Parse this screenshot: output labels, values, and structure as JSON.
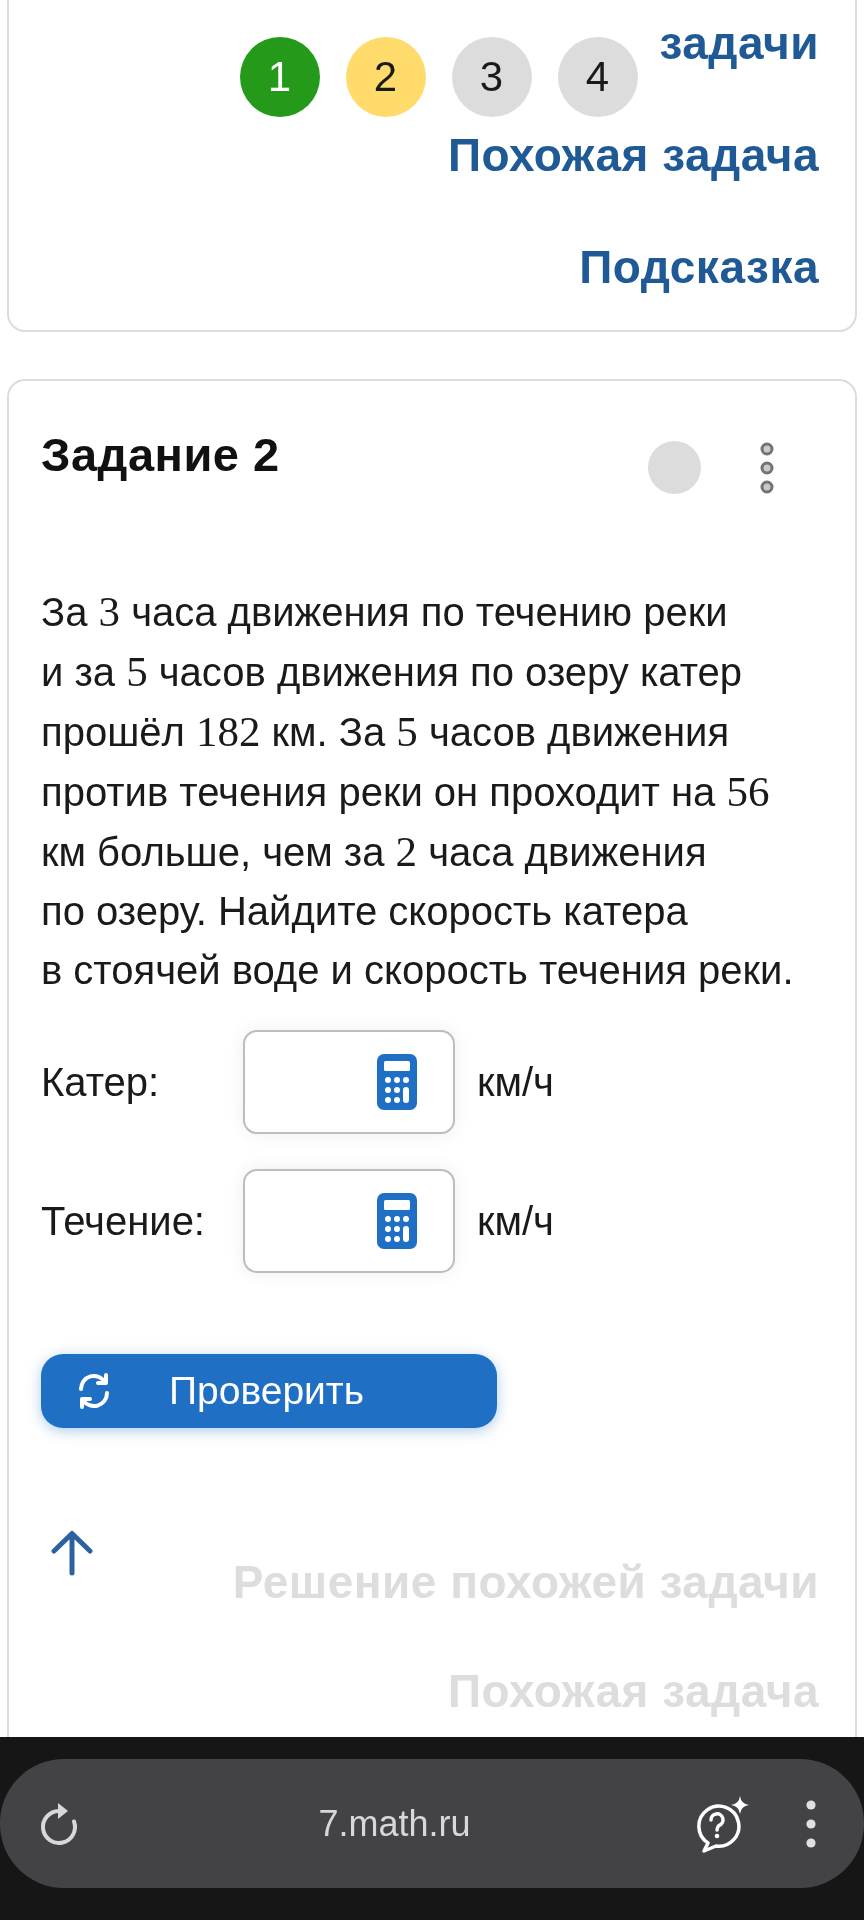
{
  "top_panel": {
    "steps": [
      {
        "label": "1",
        "color": "#259a1a"
      },
      {
        "label": "2",
        "color": "#fedb6a"
      },
      {
        "label": "3",
        "color": "#dcdcdc"
      },
      {
        "label": "4",
        "color": "#dcdcdc"
      }
    ],
    "links": [
      {
        "text": "задачи",
        "disabled": false
      },
      {
        "text": "Похожая задача",
        "disabled": false
      },
      {
        "text": "Подсказка",
        "disabled": false
      }
    ]
  },
  "task": {
    "title": "Задание 2",
    "problem": [
      {
        "kind": "text",
        "text": "За "
      },
      {
        "kind": "math",
        "text": "3"
      },
      {
        "kind": "text",
        "text": " часа движения по течению реки и за "
      },
      {
        "kind": "math",
        "text": "5"
      },
      {
        "kind": "text",
        "text": " часов движения по озеру катер прошёл "
      },
      {
        "kind": "math",
        "text": "182"
      },
      {
        "kind": "text",
        "text": " км. За "
      },
      {
        "kind": "math",
        "text": "5"
      },
      {
        "kind": "text",
        "text": " часов движения против течения реки он проходит на "
      },
      {
        "kind": "math",
        "text": "56"
      },
      {
        "kind": "text",
        "text": " км больше, чем за "
      },
      {
        "kind": "math",
        "text": "2"
      },
      {
        "kind": "text",
        "text": " часа движения по озеру. Найдите скорость катера в стоячей воде и скорость течения реки."
      }
    ],
    "answers": [
      {
        "label": "Катер:",
        "unit": "км/ч"
      },
      {
        "label": "Течение:",
        "unit": "км/ч"
      }
    ],
    "check_button": "Проверить",
    "links": [
      {
        "text": "Решение похожей задачи",
        "disabled": true
      },
      {
        "text": "Похожая задача",
        "disabled": true
      }
    ]
  },
  "browser": {
    "url": "7.math.ru"
  }
}
